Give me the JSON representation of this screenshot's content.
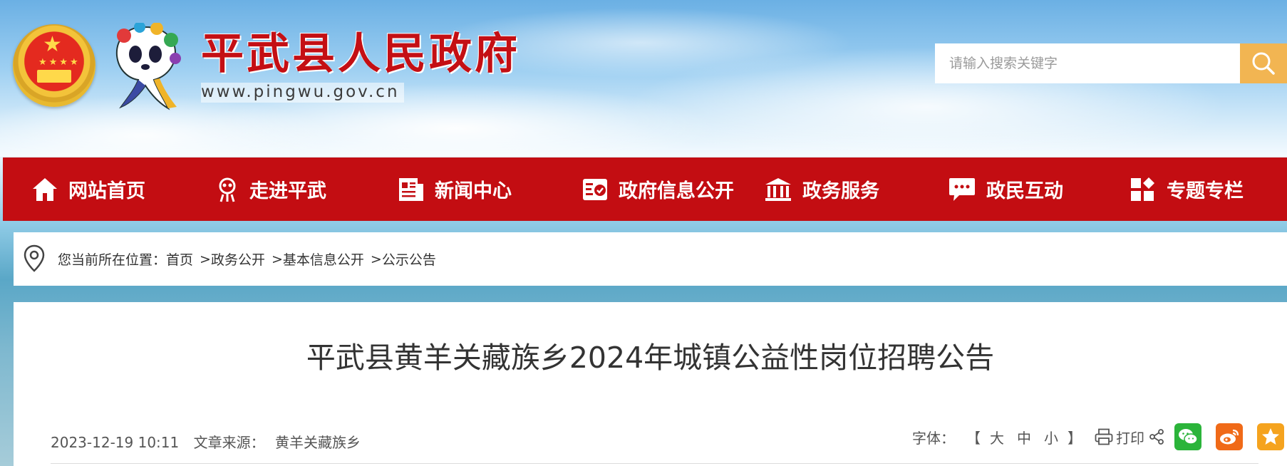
{
  "header": {
    "site_title": "平武县人民政府",
    "site_url": "www.pingwu.gov.cn",
    "search_placeholder": "请输入搜索关键字"
  },
  "nav": {
    "items": [
      {
        "label": "网站首页",
        "icon": "home-icon"
      },
      {
        "label": "走进平武",
        "icon": "panda-icon"
      },
      {
        "label": "新闻中心",
        "icon": "newspaper-icon"
      },
      {
        "label": "政府信息公开",
        "icon": "check-document-icon"
      },
      {
        "label": "政务服务",
        "icon": "government-building-icon"
      },
      {
        "label": "政民互动",
        "icon": "chat-bubble-icon"
      },
      {
        "label": "专题专栏",
        "icon": "grid-icon"
      }
    ]
  },
  "breadcrumb": {
    "prefix": "您当前所在位置：",
    "items": [
      "首页",
      "政务公开",
      "基本信息公开",
      "公示公告"
    ],
    "separator": ">"
  },
  "article": {
    "title": "平武县黄羊关藏族乡2024年城镇公益性岗位招聘公告",
    "date": "2023-12-19 10:11",
    "source_label": "文章来源：",
    "source": "黄羊关藏族乡"
  },
  "tools": {
    "font_label": "字体：",
    "bracket_open": "【",
    "bracket_close": "】",
    "size_large": "大",
    "size_medium": "中",
    "size_small": "小",
    "print_label": "打印"
  },
  "colors": {
    "nav_red": "#c30d12",
    "title_red": "#c40f14",
    "search_orange": "#f2b552",
    "wechat_green": "#2bb43a",
    "weibo_orange": "#f06a18",
    "favorite_orange": "#f5a31e"
  }
}
